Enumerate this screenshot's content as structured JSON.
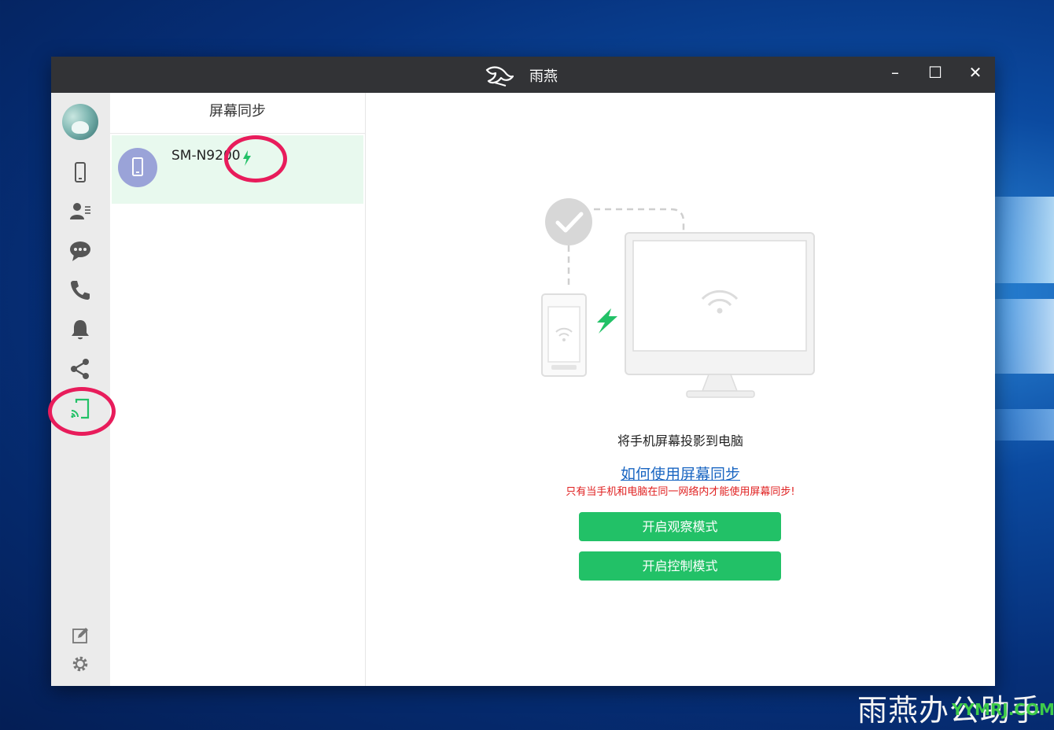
{
  "window": {
    "title": "雨燕",
    "logo_icon": "swallow-logo-icon",
    "controls": {
      "minimize": "–",
      "maximize": "☐",
      "close": "✕"
    }
  },
  "nav": {
    "items": [
      {
        "name": "phone",
        "icon": "phone-device-icon",
        "active": false
      },
      {
        "name": "contacts",
        "icon": "contacts-icon",
        "active": false
      },
      {
        "name": "messages",
        "icon": "chat-bubble-icon",
        "active": false
      },
      {
        "name": "calls",
        "icon": "call-icon",
        "active": false
      },
      {
        "name": "notifications",
        "icon": "bell-icon",
        "active": false
      },
      {
        "name": "share",
        "icon": "share-icon",
        "active": false
      },
      {
        "name": "screen-sync",
        "icon": "cast-icon",
        "active": true
      }
    ],
    "bottom": [
      {
        "name": "edit",
        "icon": "edit-icon"
      },
      {
        "name": "settings",
        "icon": "gear-icon"
      }
    ]
  },
  "list": {
    "header": "屏幕同步",
    "devices": [
      {
        "name": "SM-N9200",
        "connected": true
      }
    ]
  },
  "content": {
    "description": "将手机屏幕投影到电脑",
    "help_link": "如何使用屏幕同步",
    "warning": "只有当手机和电脑在同一网络内才能使用屏幕同步!",
    "btn_observe": "开启观察模式",
    "btn_control": "开启控制模式"
  },
  "watermark": {
    "text": "雨燕办公助手",
    "url": "YYMRJ.COM"
  },
  "colors": {
    "accent_green": "#22c167",
    "titlebar": "#323336",
    "rail": "#ebebeb",
    "highlight": "#e81c5b",
    "link": "#1a66c2",
    "warning": "#e02020"
  }
}
